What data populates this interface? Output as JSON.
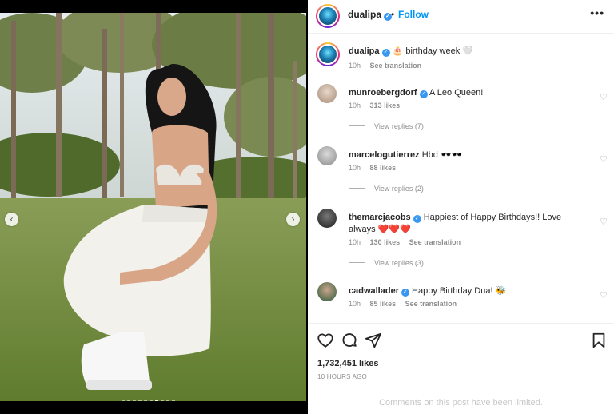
{
  "post": {
    "username": "dualipa",
    "follow_label": "Follow",
    "separator": "•",
    "more_label": "•••",
    "caption": "🎂 birthday week 🤍",
    "caption_time": "10h",
    "caption_translation": "See translation"
  },
  "carousel": {
    "prev_label": "‹",
    "next_label": "›",
    "slide_count": 10,
    "active_slide": 7
  },
  "comments": [
    {
      "username": "munroebergdorf",
      "text": "A Leo Queen!",
      "time": "10h",
      "likes": "313 likes",
      "translation": "",
      "view_replies": "View replies (7)"
    },
    {
      "username": "marcelogutierrez",
      "text": "Hbd 🕶️🕶️",
      "time": "10h",
      "likes": "88 likes",
      "translation": "",
      "view_replies": "View replies (2)"
    },
    {
      "username": "themarcjacobs",
      "text": "Happiest of Happy Birthdays!! Love always ❤️❤️❤️",
      "time": "10h",
      "likes": "130 likes",
      "translation": "See translation",
      "view_replies": "View replies (3)"
    },
    {
      "username": "cadwallader",
      "text": "Happy Birthday Dua! 🐝",
      "time": "10h",
      "likes": "85 likes",
      "translation": "See translation",
      "view_replies": ""
    }
  ],
  "footer": {
    "likes_count": "1,732,451 likes",
    "timestamp": "10 HOURS AGO",
    "comments_limited": "Comments on this post have been limited."
  },
  "icons": {
    "heart": "heart-icon",
    "comment": "comment-icon",
    "share": "share-icon",
    "save": "bookmark-icon",
    "verified": "verified-badge-icon"
  },
  "colors": {
    "follow_blue": "#0095f6",
    "verified_blue": "#3897f0",
    "muted_text": "#8e8e8e"
  }
}
